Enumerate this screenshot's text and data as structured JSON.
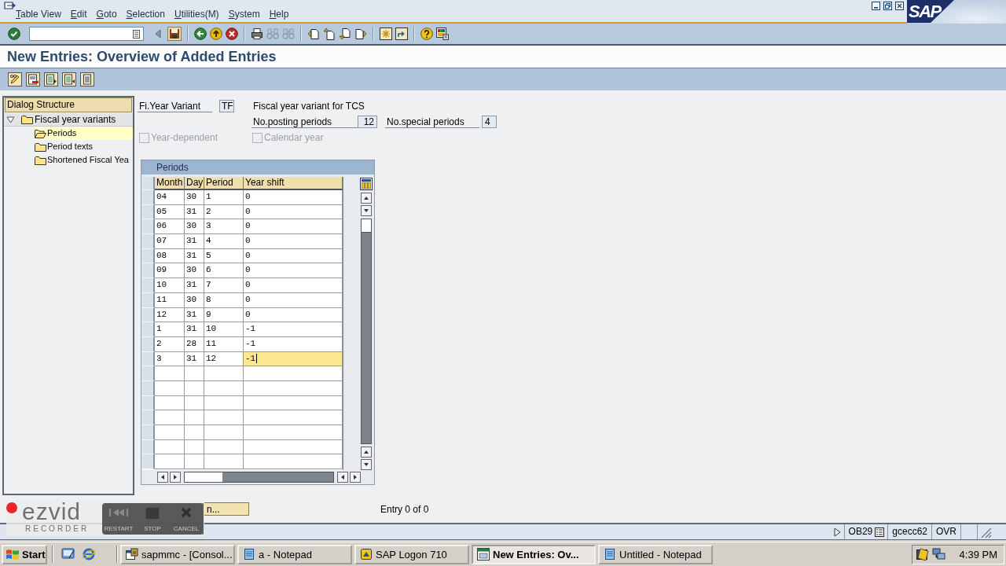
{
  "window": {
    "logo": "SAP"
  },
  "menu": [
    {
      "label": "Table View"
    },
    {
      "label": "Edit"
    },
    {
      "label": "Goto"
    },
    {
      "label": "Selection"
    },
    {
      "label": "Utilities(M)"
    },
    {
      "label": "System"
    },
    {
      "label": "Help"
    }
  ],
  "screen_title": "New Entries: Overview of Added Entries",
  "dialog_structure": {
    "title": "Dialog Structure",
    "items": [
      {
        "label": "Fiscal year variants",
        "expanded": true,
        "selected": false,
        "children": [
          {
            "label": "Periods",
            "selected": true
          },
          {
            "label": "Period texts",
            "selected": false
          },
          {
            "label": "Shortened Fiscal Yea",
            "selected": false
          }
        ]
      }
    ]
  },
  "header": {
    "variant": {
      "label": "Fi.Year Variant",
      "value": "TF",
      "description": "Fiscal year variant for TCS"
    },
    "posting_periods": {
      "label": "No.posting periods",
      "value": "12"
    },
    "special_periods": {
      "label": "No.special periods",
      "value": "4"
    },
    "checkboxes": [
      {
        "label": "Year-dependent",
        "checked": false,
        "disabled": true
      },
      {
        "label": "Calendar year",
        "checked": false,
        "disabled": true
      }
    ]
  },
  "table": {
    "title": "Periods",
    "columns": [
      "Month",
      "Day",
      "Period",
      "Year shift"
    ],
    "rows": [
      {
        "cells": [
          "04",
          "30",
          "1",
          "0"
        ],
        "focused": false
      },
      {
        "cells": [
          "05",
          "31",
          "2",
          "0"
        ],
        "focused": false
      },
      {
        "cells": [
          "06",
          "30",
          "3",
          "0"
        ],
        "focused": false
      },
      {
        "cells": [
          "07",
          "31",
          "4",
          "0"
        ],
        "focused": false
      },
      {
        "cells": [
          "08",
          "31",
          "5",
          "0"
        ],
        "focused": false
      },
      {
        "cells": [
          "09",
          "30",
          "6",
          "0"
        ],
        "focused": false
      },
      {
        "cells": [
          "10",
          "31",
          "7",
          "0"
        ],
        "focused": false
      },
      {
        "cells": [
          "11",
          "30",
          "8",
          "0"
        ],
        "focused": false
      },
      {
        "cells": [
          "12",
          "31",
          "9",
          "0"
        ],
        "focused": false
      },
      {
        "cells": [
          "1",
          "31",
          "10",
          "-1"
        ],
        "focused": false
      },
      {
        "cells": [
          "2",
          "28",
          "11",
          "-1"
        ],
        "focused": false
      },
      {
        "cells": [
          "3",
          "31",
          "12",
          "-1"
        ],
        "focused": true
      }
    ]
  },
  "position_button": {
    "label": "n..."
  },
  "entry_counter": "Entry 0 of 0",
  "status_bar": {
    "transaction": "OB29",
    "server": "gcecc62",
    "mode": "OVR"
  },
  "recorder": {
    "logo": "ezvid",
    "subtitle": "RECORDER",
    "buttons": [
      {
        "label": "RESTART",
        "kind": "restart"
      },
      {
        "label": "STOP",
        "kind": "stop"
      },
      {
        "label": "CANCEL",
        "kind": "cancel"
      }
    ]
  },
  "taskbar": {
    "start": "Start",
    "tasks": [
      {
        "label": "sapmmc - [Consol...",
        "kind": "console",
        "selected": false
      },
      {
        "label": "a - Notepad",
        "kind": "notepad",
        "selected": false
      },
      {
        "label": "SAP Logon 710",
        "kind": "logon",
        "selected": false
      },
      {
        "label": "New Entries: Ov...",
        "kind": "sapgui",
        "selected": true
      },
      {
        "label": "Untitled - Notepad",
        "kind": "notepad",
        "selected": false
      }
    ],
    "clock": "4:39 PM"
  }
}
